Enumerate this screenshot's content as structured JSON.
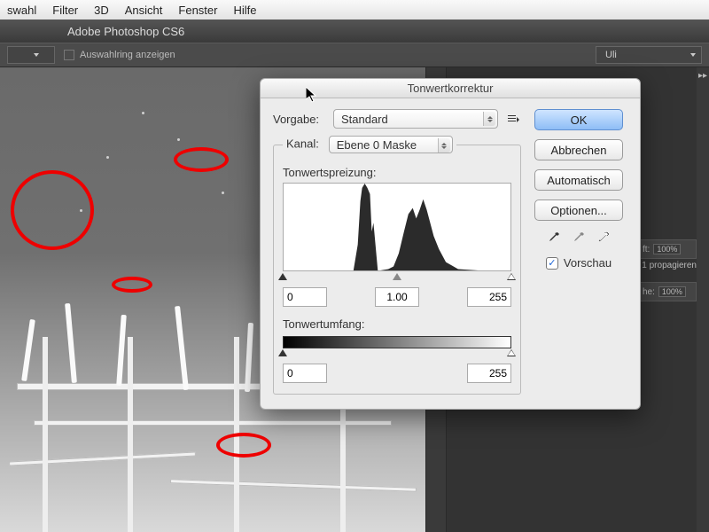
{
  "mac_menu": {
    "items": [
      "swahl",
      "Filter",
      "3D",
      "Ansicht",
      "Fenster",
      "Hilfe"
    ]
  },
  "app": {
    "title": "Adobe Photoshop CS6"
  },
  "options": {
    "show_selection_ring_label": "Auswahlring anzeigen",
    "user_preset": "Uli"
  },
  "panel_props": {
    "opacity_label": "ft:",
    "opacity_value": "100%",
    "propagate_label": "1 propagieren",
    "fill_label": "he:",
    "fill_value": "100%"
  },
  "dialog": {
    "title": "Tonwertkorrektur",
    "preset_label": "Vorgabe:",
    "preset_value": "Standard",
    "channel_label": "Kanal:",
    "channel_value": "Ebene 0 Maske",
    "input_levels_label": "Tonwertspreizung:",
    "black": "0",
    "gamma": "1.00",
    "white": "255",
    "output_levels_label": "Tonwertumfang:",
    "out_black": "0",
    "out_white": "255",
    "ok": "OK",
    "cancel": "Abbrechen",
    "auto": "Automatisch",
    "options": "Optionen...",
    "preview": "Vorschau"
  }
}
